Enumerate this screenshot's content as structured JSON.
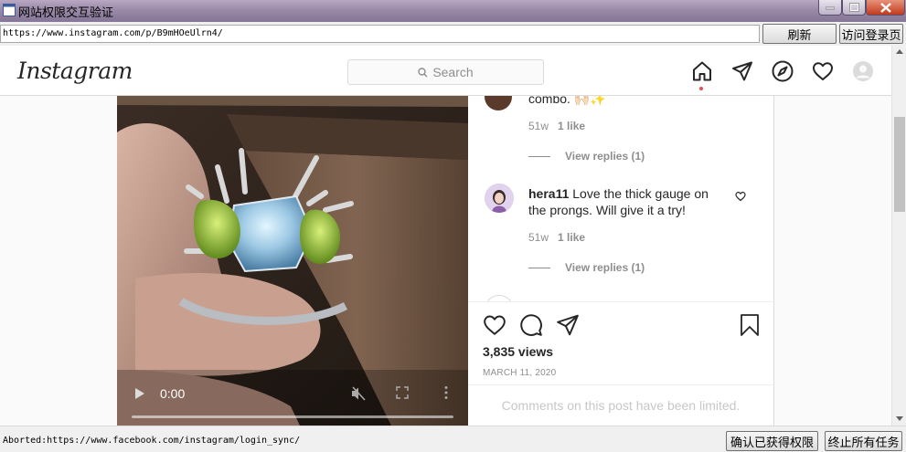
{
  "window": {
    "title": "网站权限交互验证",
    "url": "https://www.instagram.com/p/B9mHOeUlrn4/",
    "refresh_label": "刷新",
    "login_label": "访问登录页"
  },
  "header": {
    "logo": "Instagram",
    "search_placeholder": "Search"
  },
  "video": {
    "time": "0:00",
    "progress": 0
  },
  "comments": [
    {
      "text": "combo. 🙌🏻✨",
      "age": "51w",
      "likes": "1 like",
      "replies": "View replies (1)"
    },
    {
      "user": "hera11",
      "text": " Love the thick gauge on the prongs. Will give it a try!",
      "age": "51w",
      "likes": "1 like",
      "replies": "View replies (1)"
    }
  ],
  "post": {
    "views": "3,835 views",
    "date": "MARCH 11, 2020",
    "limited_notice": "Comments on this post have been limited."
  },
  "status": {
    "text": "Aborted:https://www.facebook.com/instagram/login_sync/",
    "confirm_label": "确认已获得权限",
    "stop_label": "终止所有任务"
  },
  "colors": {
    "notification_dot": "#ed4956",
    "ig_text": "#262626",
    "ig_muted": "#8e8e8e"
  }
}
